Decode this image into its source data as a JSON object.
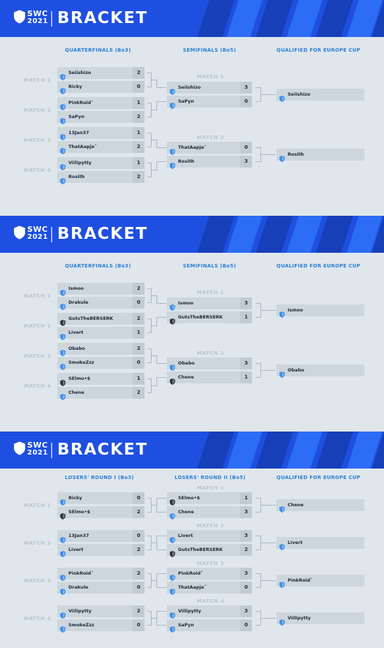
{
  "colors": {
    "banner": "#1e4fe0",
    "header_text": "#2b7fd4",
    "match_label": "#b7c4ce",
    "row_bg": "#cdd6dd",
    "score_bg": "#c1cbd3",
    "icon_blue": "#3a8ee6",
    "icon_dark": "#2a3440"
  },
  "panels": [
    {
      "logo": {
        "top": "SWC",
        "bottom": "2021"
      },
      "title": "BRACKET",
      "headers": [
        "QUARTERFINALS (Bo3)",
        "SEMIFINALS (Bo5)",
        "QUALIFIED FOR EUROPE CUP"
      ],
      "qf_labels": [
        "MATCH 1",
        "MATCH 2",
        "MATCH 3",
        "MATCH 4"
      ],
      "sf_labels": [
        "MATCH 1",
        "MATCH 2"
      ],
      "qf": [
        [
          {
            "name": "Seiishizo",
            "score": "2",
            "icon": "blue"
          },
          {
            "name": "Ricky",
            "score": "0",
            "icon": "blue"
          }
        ],
        [
          {
            "name": "PinkRoid˝",
            "score": "1",
            "icon": "blue"
          },
          {
            "name": "SaPyn",
            "score": "2",
            "icon": "blue"
          }
        ],
        [
          {
            "name": "13Jan37",
            "score": "1",
            "icon": "blue"
          },
          {
            "name": "ThatAapje˝",
            "score": "2",
            "icon": "blue"
          }
        ],
        [
          {
            "name": "Viilipytty",
            "score": "1",
            "icon": "blue"
          },
          {
            "name": "Rosith",
            "score": "2",
            "icon": "blue"
          }
        ]
      ],
      "sf": [
        [
          {
            "name": "Seiishizo",
            "score": "3",
            "icon": "blue"
          },
          {
            "name": "SaPyn",
            "score": "0",
            "icon": "blue"
          }
        ],
        [
          {
            "name": "ThatAapje˝",
            "score": "0",
            "icon": "blue"
          },
          {
            "name": "Rosith",
            "score": "3",
            "icon": "blue"
          }
        ]
      ],
      "qualified": [
        {
          "name": "Seiishizo",
          "icon": "blue"
        },
        {
          "name": "Rosith",
          "icon": "blue"
        }
      ]
    },
    {
      "logo": {
        "top": "SWC",
        "bottom": "2021"
      },
      "title": "BRACKET",
      "headers": [
        "QUARTERFINALS (Bo3)",
        "SEMIFINALS (Bo5)",
        "QUALIFIED FOR EUROPE CUP"
      ],
      "qf_labels": [
        "MATCH 1",
        "MATCH 2",
        "MATCH 3",
        "MATCH 4"
      ],
      "sf_labels": [
        "MATCH 1",
        "MATCH 2"
      ],
      "qf": [
        [
          {
            "name": "Ismoo",
            "score": "2",
            "icon": "blue"
          },
          {
            "name": "Drakule",
            "score": "0",
            "icon": "blue"
          }
        ],
        [
          {
            "name": "GutsTheBERSERK",
            "score": "2",
            "icon": "dark"
          },
          {
            "name": "Livert",
            "score": "1",
            "icon": "blue"
          }
        ],
        [
          {
            "name": "Obabo",
            "score": "2",
            "icon": "blue"
          },
          {
            "name": "SmokeZzz",
            "score": "0",
            "icon": "blue"
          }
        ],
        [
          {
            "name": "SElmo•$",
            "score": "1",
            "icon": "dark"
          },
          {
            "name": "Chene",
            "score": "2",
            "icon": "blue"
          }
        ]
      ],
      "sf": [
        [
          {
            "name": "Ismoo",
            "score": "3",
            "icon": "blue"
          },
          {
            "name": "GutsTheBERSERK",
            "score": "1",
            "icon": "dark"
          }
        ],
        [
          {
            "name": "Obabo",
            "score": "3",
            "icon": "blue"
          },
          {
            "name": "Chene",
            "score": "1",
            "icon": "dark"
          }
        ]
      ],
      "qualified": [
        {
          "name": "Ismoo",
          "icon": "blue"
        },
        {
          "name": "Obabo",
          "icon": "blue"
        }
      ]
    },
    {
      "logo": {
        "top": "SWC",
        "bottom": "2021"
      },
      "title": "BRACKET",
      "headers": [
        "LOSERS' ROUND I (Bo3)",
        "LOSERS' ROUND II (Bo5)",
        "QUALIFIED FOR EUROPE CUP"
      ],
      "qf_labels": [
        "MATCH 1",
        "MATCH 2",
        "MATCH 3",
        "MATCH 4"
      ],
      "sf_labels": [
        "MATCH 1",
        "MATCH 2",
        "MATCH 3",
        "MATCH 4"
      ],
      "qf": [
        [
          {
            "name": "Ricky",
            "score": "0",
            "icon": "blue"
          },
          {
            "name": "SElmo•$",
            "score": "2",
            "icon": "dark"
          }
        ],
        [
          {
            "name": "13Jan37",
            "score": "0",
            "icon": "blue"
          },
          {
            "name": "Livert",
            "score": "2",
            "icon": "blue"
          }
        ],
        [
          {
            "name": "PinkRoid˝",
            "score": "2",
            "icon": "blue"
          },
          {
            "name": "Drakule",
            "score": "0",
            "icon": "blue"
          }
        ],
        [
          {
            "name": "Viilipytty",
            "score": "2",
            "icon": "blue"
          },
          {
            "name": "SmokeZzz",
            "score": "0",
            "icon": "blue"
          }
        ]
      ],
      "sf": [
        [
          {
            "name": "SElmo•$",
            "score": "1",
            "icon": "dark"
          },
          {
            "name": "Chene",
            "score": "3",
            "icon": "blue"
          }
        ],
        [
          {
            "name": "Livert",
            "score": "3",
            "icon": "blue"
          },
          {
            "name": "GutsTheBERSERK",
            "score": "2",
            "icon": "dark"
          }
        ],
        [
          {
            "name": "PinkRoid˝",
            "score": "3",
            "icon": "blue"
          },
          {
            "name": "ThatAapje˝",
            "score": "0",
            "icon": "blue"
          }
        ],
        [
          {
            "name": "Viilipytty",
            "score": "3",
            "icon": "blue"
          },
          {
            "name": "SaPyn",
            "score": "0",
            "icon": "blue"
          }
        ]
      ],
      "qualified": [
        {
          "name": "Chene",
          "icon": "blue"
        },
        {
          "name": "Livert",
          "icon": "blue"
        },
        {
          "name": "PinkRoid˝",
          "icon": "blue"
        },
        {
          "name": "Viilipytty",
          "icon": "blue"
        }
      ]
    }
  ]
}
